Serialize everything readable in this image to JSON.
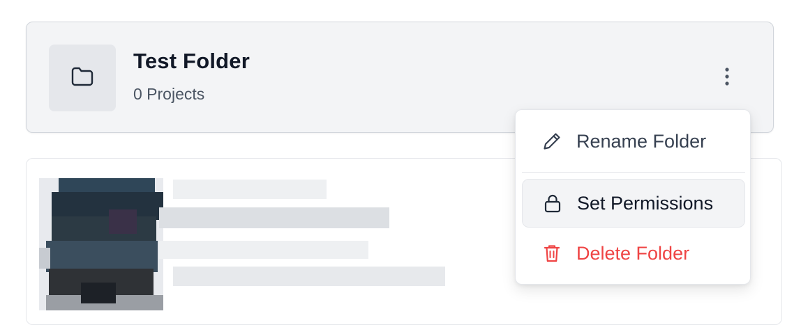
{
  "folder": {
    "title": "Test Folder",
    "project_count": "0 Projects",
    "icon": "folder-icon",
    "menu_icon": "kebab-icon"
  },
  "menu": {
    "items": [
      {
        "label": "Rename Folder",
        "icon": "pencil-icon"
      },
      {
        "label": "Set Permissions",
        "icon": "lock-icon"
      },
      {
        "label": "Delete Folder",
        "icon": "trash-icon"
      }
    ]
  },
  "colors": {
    "danger": "#ef4444",
    "card_bg": "#f3f4f6",
    "text_primary": "#111827",
    "text_secondary": "#4b5563"
  }
}
